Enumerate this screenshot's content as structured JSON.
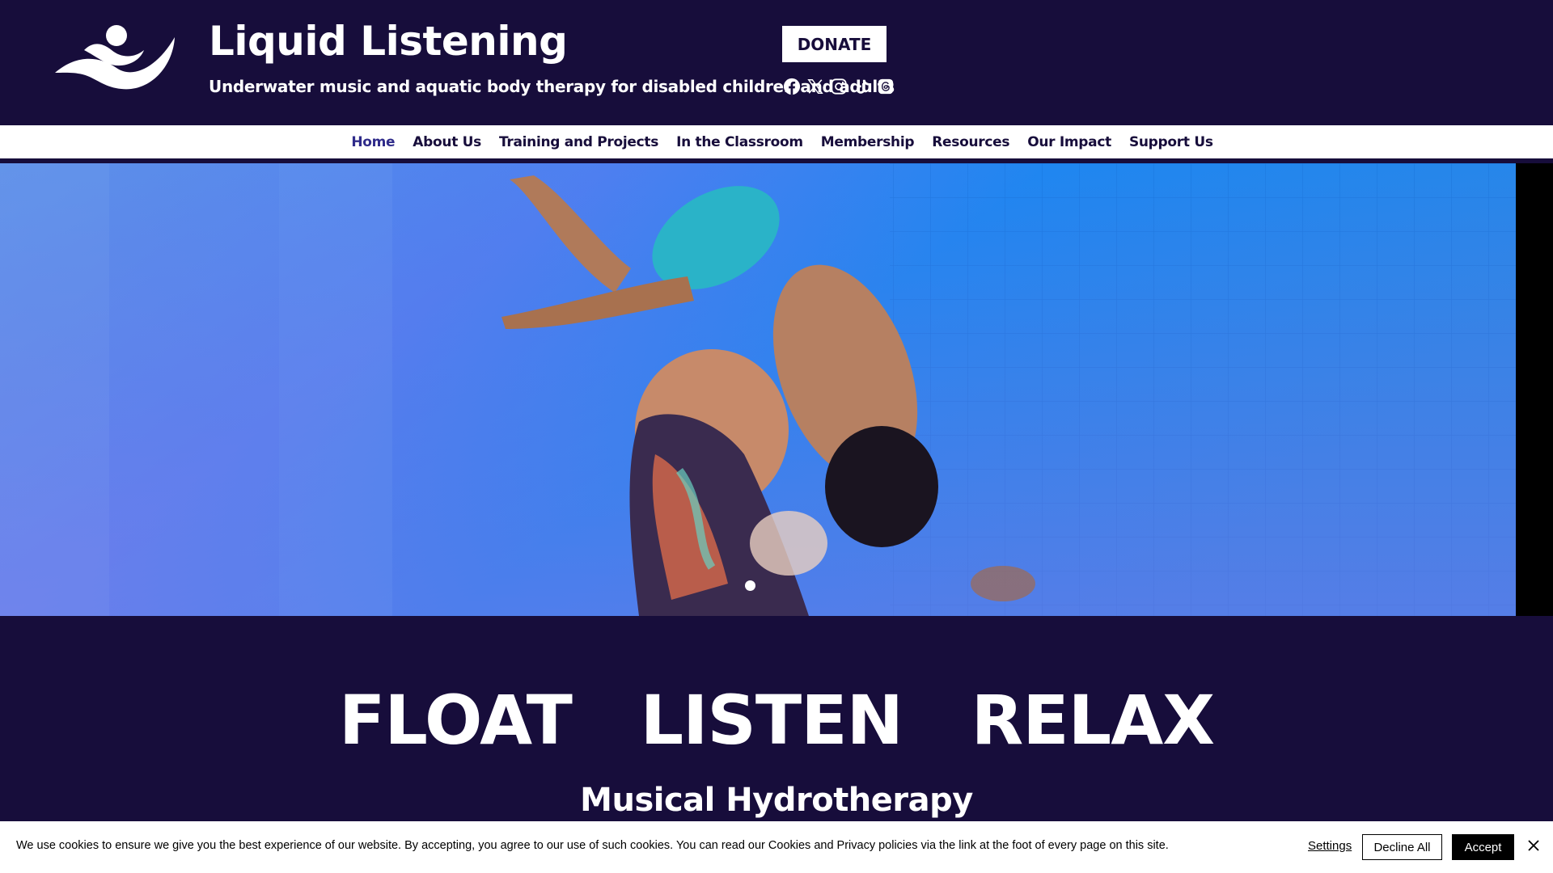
{
  "header": {
    "title": "Liquid Listening",
    "tagline": "Underwater music and aquatic body therapy for disabled children and adults",
    "donate_label": "DONATE",
    "social_icons": [
      "facebook-icon",
      "x-icon",
      "instagram-icon",
      "tiktok-icon",
      "threads-icon"
    ]
  },
  "nav": {
    "items": [
      {
        "label": "Home",
        "active": true
      },
      {
        "label": "About Us"
      },
      {
        "label": "Training and Projects"
      },
      {
        "label": "In the Classroom"
      },
      {
        "label": "Membership"
      },
      {
        "label": "Resources"
      },
      {
        "label": "Our Impact"
      },
      {
        "label": "Support Us"
      }
    ]
  },
  "hero": {
    "slide_count": 1,
    "active_slide": 1
  },
  "main": {
    "headline": "FLOAT   LISTEN   RELAX",
    "subheadline": "Musical Hydrotherapy"
  },
  "cookie": {
    "text": "We use cookies to ensure we give you the best experience of our website. By accepting, you agree to our use of such cookies. You can read our Cookies and Privacy policies via the link at the foot of every page on this site.",
    "settings_label": "Settings",
    "decline_label": "Decline All",
    "accept_label": "Accept"
  },
  "colors": {
    "brand_navy": "#170d3b",
    "nav_active": "#2f2b8a",
    "pool_blue": "#2f7fe8"
  }
}
